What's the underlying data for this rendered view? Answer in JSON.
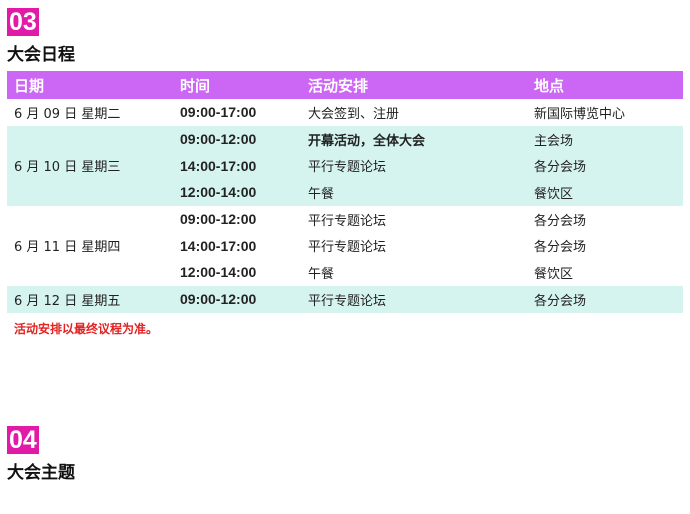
{
  "section3": {
    "number": "03",
    "title": "大会日程"
  },
  "schedule": {
    "headers": [
      "日期",
      "时间",
      "活动安排",
      "地点"
    ],
    "days": [
      {
        "date": "6 月 09 日  星期二",
        "sessions": [
          {
            "time": "09:00-17:00",
            "activity": "大会签到、注册",
            "venue": "新国际博览中心"
          }
        ]
      },
      {
        "date": "6 月 10 日  星期三",
        "sessions": [
          {
            "time": "09:00-12:00",
            "activity": "开幕活动，全体大会",
            "venue": "主会场"
          },
          {
            "time": "14:00-17:00",
            "activity": "平行专题论坛",
            "venue": "各分会场"
          },
          {
            "time": "12:00-14:00",
            "activity": "午餐",
            "venue": "餐饮区"
          }
        ]
      },
      {
        "date": "6 月 11 日  星期四",
        "sessions": [
          {
            "time": "09:00-12:00",
            "activity": "平行专题论坛",
            "venue": "各分会场"
          },
          {
            "time": "14:00-17:00",
            "activity": "平行专题论坛",
            "venue": "各分会场"
          },
          {
            "time": "12:00-14:00",
            "activity": "午餐",
            "venue": "餐饮区"
          }
        ]
      },
      {
        "date": "6 月 12 日  星期五",
        "sessions": [
          {
            "time": "09:00-12:00",
            "activity": "平行专题论坛",
            "venue": "各分会场"
          }
        ]
      }
    ],
    "note": "活动安排以最终议程为准。"
  },
  "section4": {
    "number": "04",
    "title": "大会主题"
  },
  "colors": {
    "section_badge": "#e11aa7",
    "table_header": "#cc66f5",
    "row_tint": "#d5f4f0",
    "note_text": "#e32222"
  }
}
